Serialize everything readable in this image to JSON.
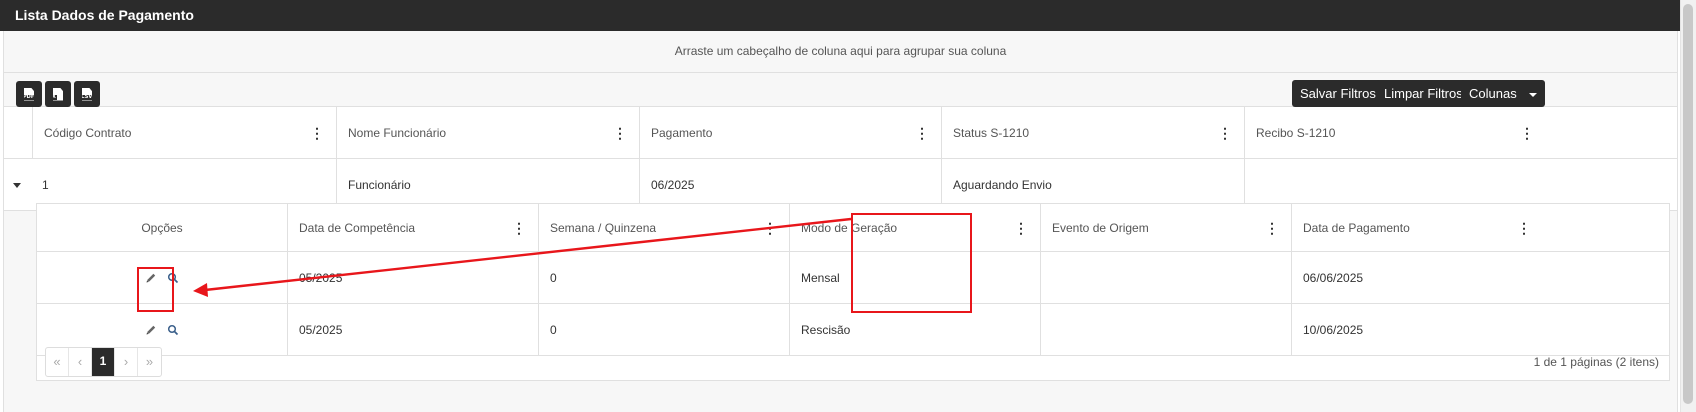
{
  "panel": {
    "title": "Lista Dados de Pagamento"
  },
  "group_panel": {
    "hint": "Arraste um cabeçalho de coluna aqui para agrupar sua coluna"
  },
  "toolbar": {
    "export_pdf_label": "PDF",
    "export_xls_label": "X",
    "export_csv_label": "CSV",
    "save_filters_label": "Salvar Filtros",
    "clear_filters_label": "Limpar Filtros",
    "columns_label": "Colunas"
  },
  "main_grid": {
    "columns": [
      "Código Contrato",
      "Nome Funcionário",
      "Pagamento",
      "Status S-1210",
      "Recibo S-1210"
    ],
    "rows": [
      {
        "codigo": "1",
        "nome": "Funcionário",
        "pagamento": "06/2025",
        "status": "Aguardando Envio",
        "recibo": ""
      }
    ]
  },
  "detail_grid": {
    "columns": [
      "Opções",
      "Data de Competência",
      "Semana / Quinzena",
      "Modo de Geração",
      "Evento de Origem",
      "Data de Pagamento"
    ],
    "rows": [
      {
        "competencia": "05/2025",
        "semana": "0",
        "modo": "Mensal",
        "evento": "",
        "data_pagamento": "06/06/2025"
      },
      {
        "competencia": "05/2025",
        "semana": "0",
        "modo": "Rescisão",
        "evento": "",
        "data_pagamento": "10/06/2025"
      }
    ]
  },
  "pager": {
    "first": "«",
    "prev": "‹",
    "current_page": "1",
    "next": "›",
    "last": "»",
    "info": "1 de 1 páginas (2 itens)"
  },
  "colors": {
    "header_bg": "#2b2b2b",
    "annotation": "#e8161b"
  }
}
